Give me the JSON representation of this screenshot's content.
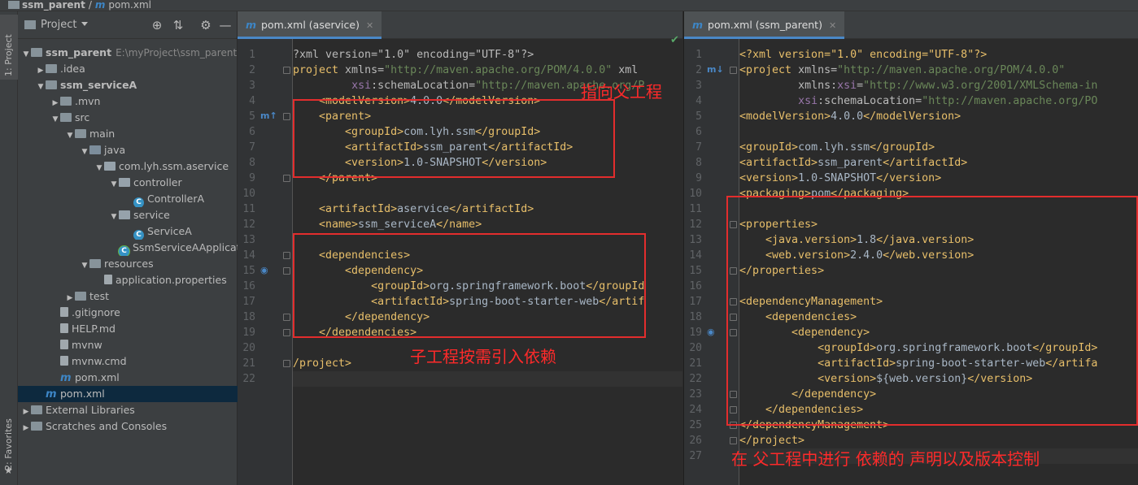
{
  "breadcrumb": {
    "project": "ssm_parent",
    "file": "pom.xml"
  },
  "toolstrip": {
    "project_tab": "1: Project",
    "favorites_tab": "2: Favorites"
  },
  "project_panel": {
    "title": "Project",
    "tree": [
      {
        "label": "ssm_parent",
        "extra": "E:\\myProject\\ssm_parent",
        "indent": 0,
        "arrow": "down",
        "icon": "module-folder-icon",
        "bold": true
      },
      {
        "label": ".idea",
        "indent": 1,
        "arrow": "right",
        "icon": "folder-icon"
      },
      {
        "label": "ssm_serviceA",
        "indent": 1,
        "arrow": "down",
        "icon": "module-folder-icon",
        "bold": true
      },
      {
        "label": ".mvn",
        "indent": 2,
        "arrow": "right",
        "icon": "folder-icon"
      },
      {
        "label": "src",
        "indent": 2,
        "arrow": "down",
        "icon": "folder-icon"
      },
      {
        "label": "main",
        "indent": 3,
        "arrow": "down",
        "icon": "folder-icon"
      },
      {
        "label": "java",
        "indent": 4,
        "arrow": "down",
        "icon": "source-folder-icon"
      },
      {
        "label": "com.lyh.ssm.aservice",
        "indent": 5,
        "arrow": "down",
        "icon": "package-icon"
      },
      {
        "label": "controller",
        "indent": 6,
        "arrow": "down",
        "icon": "package-icon"
      },
      {
        "label": "ControllerA",
        "indent": 7,
        "arrow": "",
        "icon": "class-icon"
      },
      {
        "label": "service",
        "indent": 6,
        "arrow": "down",
        "icon": "package-icon"
      },
      {
        "label": "ServiceA",
        "indent": 7,
        "arrow": "",
        "icon": "class-icon"
      },
      {
        "label": "SsmServiceAApplication",
        "indent": 6,
        "arrow": "",
        "icon": "spring-class-icon"
      },
      {
        "label": "resources",
        "indent": 4,
        "arrow": "down",
        "icon": "resources-folder-icon"
      },
      {
        "label": "application.properties",
        "indent": 5,
        "arrow": "",
        "icon": "properties-icon"
      },
      {
        "label": "test",
        "indent": 3,
        "arrow": "right",
        "icon": "folder-icon"
      },
      {
        "label": ".gitignore",
        "indent": 2,
        "arrow": "",
        "icon": "file-icon"
      },
      {
        "label": "HELP.md",
        "indent": 2,
        "arrow": "",
        "icon": "markdown-icon"
      },
      {
        "label": "mvnw",
        "indent": 2,
        "arrow": "",
        "icon": "file-icon"
      },
      {
        "label": "mvnw.cmd",
        "indent": 2,
        "arrow": "",
        "icon": "file-icon"
      },
      {
        "label": "pom.xml",
        "indent": 2,
        "arrow": "",
        "icon": "maven-icon"
      },
      {
        "label": "pom.xml",
        "indent": 1,
        "arrow": "",
        "icon": "maven-icon",
        "selected": true
      },
      {
        "label": "External Libraries",
        "indent": 0,
        "arrow": "right",
        "icon": "library-icon"
      },
      {
        "label": "Scratches and Consoles",
        "indent": 0,
        "arrow": "right",
        "icon": "scratches-icon"
      }
    ]
  },
  "left_editor": {
    "tab": "pom.xml (aservice)",
    "lines": [
      [
        [
          "p",
          "?xml version=\"1.0\" encoding=\"UTF-8\"?>"
        ]
      ],
      [
        [
          "t",
          "project "
        ],
        [
          "a",
          "xmlns="
        ],
        [
          "v",
          "\"http://maven.apache.org/POM/4.0.0\" "
        ],
        [
          "a",
          "xml"
        ]
      ],
      [
        [
          "p",
          "         "
        ],
        [
          "ns",
          "xsi"
        ],
        [
          "a",
          ":schemaLocation="
        ],
        [
          "v",
          "\"http://maven.apache.org/P"
        ]
      ],
      [
        [
          "p",
          "    "
        ],
        [
          "t",
          "<modelVersion>"
        ],
        [
          "tx",
          "4.0.0"
        ],
        [
          "t",
          "</modelVersion>"
        ]
      ],
      [
        [
          "p",
          "    "
        ],
        [
          "t",
          "<parent>"
        ]
      ],
      [
        [
          "p",
          "        "
        ],
        [
          "t",
          "<groupId>"
        ],
        [
          "tx",
          "com.lyh.ssm"
        ],
        [
          "t",
          "</groupId>"
        ]
      ],
      [
        [
          "p",
          "        "
        ],
        [
          "t",
          "<artifactId>"
        ],
        [
          "tx",
          "ssm_parent"
        ],
        [
          "t",
          "</artifactId>"
        ]
      ],
      [
        [
          "p",
          "        "
        ],
        [
          "t",
          "<version>"
        ],
        [
          "tx",
          "1.0-SNAPSHOT"
        ],
        [
          "t",
          "</version>"
        ]
      ],
      [
        [
          "p",
          "    "
        ],
        [
          "t",
          "</parent>"
        ]
      ],
      [],
      [
        [
          "p",
          "    "
        ],
        [
          "t",
          "<artifactId>"
        ],
        [
          "tx",
          "aservice"
        ],
        [
          "t",
          "</artifactId>"
        ]
      ],
      [
        [
          "p",
          "    "
        ],
        [
          "t",
          "<name>"
        ],
        [
          "tx",
          "ssm_serviceA"
        ],
        [
          "t",
          "</name>"
        ]
      ],
      [],
      [
        [
          "p",
          "    "
        ],
        [
          "t",
          "<dependencies>"
        ]
      ],
      [
        [
          "p",
          "        "
        ],
        [
          "t",
          "<dependency>"
        ]
      ],
      [
        [
          "p",
          "            "
        ],
        [
          "t",
          "<groupId>"
        ],
        [
          "tx",
          "org.springframework.boot"
        ],
        [
          "t",
          "</groupId"
        ]
      ],
      [
        [
          "p",
          "            "
        ],
        [
          "t",
          "<artifactId>"
        ],
        [
          "tx",
          "spring-boot-starter-web"
        ],
        [
          "t",
          "</artif"
        ]
      ],
      [
        [
          "p",
          "        "
        ],
        [
          "t",
          "</dependency>"
        ]
      ],
      [
        [
          "p",
          "    "
        ],
        [
          "t",
          "</dependencies>"
        ]
      ],
      [],
      [
        [
          "t",
          "/project>"
        ]
      ],
      []
    ],
    "notes": [
      "指向父工程",
      "子工程按需引入依赖"
    ]
  },
  "right_editor": {
    "tab": "pom.xml (ssm_parent)",
    "lines": [
      [
        [
          "t",
          "<?xml version=\"1.0\" encoding=\"UTF-8\"?>"
        ]
      ],
      [
        [
          "t",
          "<project "
        ],
        [
          "a",
          "xmlns="
        ],
        [
          "v",
          "\"http://maven.apache.org/POM/4.0.0\""
        ]
      ],
      [
        [
          "p",
          "         "
        ],
        [
          "a",
          "xmlns:"
        ],
        [
          "ns",
          "xsi"
        ],
        [
          "a",
          "="
        ],
        [
          "v",
          "\"http://www.w3.org/2001/XMLSchema-in"
        ]
      ],
      [
        [
          "p",
          "         "
        ],
        [
          "ns",
          "xsi"
        ],
        [
          "a",
          ":schemaLocation="
        ],
        [
          "v",
          "\"http://maven.apache.org/PO"
        ]
      ],
      [
        [
          "t",
          "<modelVersion>"
        ],
        [
          "tx",
          "4.0.0"
        ],
        [
          "t",
          "</modelVersion>"
        ]
      ],
      [],
      [
        [
          "t",
          "<groupId>"
        ],
        [
          "tx",
          "com.lyh.ssm"
        ],
        [
          "t",
          "</groupId>"
        ]
      ],
      [
        [
          "t",
          "<artifactId>"
        ],
        [
          "tx",
          "ssm_parent"
        ],
        [
          "t",
          "</artifactId>"
        ]
      ],
      [
        [
          "t",
          "<version>"
        ],
        [
          "tx",
          "1.0-SNAPSHOT"
        ],
        [
          "t",
          "</version>"
        ]
      ],
      [
        [
          "t",
          "<packaging>"
        ],
        [
          "tx",
          "pom"
        ],
        [
          "t",
          "</packaging>"
        ]
      ],
      [],
      [
        [
          "t",
          "<properties>"
        ]
      ],
      [
        [
          "p",
          "    "
        ],
        [
          "t",
          "<java.version>"
        ],
        [
          "tx",
          "1.8"
        ],
        [
          "t",
          "</java.version>"
        ]
      ],
      [
        [
          "p",
          "    "
        ],
        [
          "t",
          "<web.version>"
        ],
        [
          "tx",
          "2.4.0"
        ],
        [
          "t",
          "</web.version>"
        ]
      ],
      [
        [
          "t",
          "</properties>"
        ]
      ],
      [],
      [
        [
          "t",
          "<dependencyManagement>"
        ]
      ],
      [
        [
          "p",
          "    "
        ],
        [
          "t",
          "<dependencies>"
        ]
      ],
      [
        [
          "p",
          "        "
        ],
        [
          "t",
          "<dependency>"
        ]
      ],
      [
        [
          "p",
          "            "
        ],
        [
          "t",
          "<groupId>"
        ],
        [
          "tx",
          "org.springframework.boot"
        ],
        [
          "t",
          "</groupId>"
        ]
      ],
      [
        [
          "p",
          "            "
        ],
        [
          "t",
          "<artifactId>"
        ],
        [
          "tx",
          "spring-boot-starter-web"
        ],
        [
          "t",
          "</artifa"
        ]
      ],
      [
        [
          "p",
          "            "
        ],
        [
          "t",
          "<version>"
        ],
        [
          "tx",
          "${web.version}"
        ],
        [
          "t",
          "</version>"
        ]
      ],
      [
        [
          "p",
          "        "
        ],
        [
          "t",
          "</dependency>"
        ]
      ],
      [
        [
          "p",
          "    "
        ],
        [
          "t",
          "</dependencies>"
        ]
      ],
      [
        [
          "t",
          "</dependencyManagement>"
        ]
      ],
      [
        [
          "t",
          "</project>"
        ]
      ],
      []
    ],
    "notes": [
      "在 父工程中进行 依赖的 声明以及版本控制"
    ]
  }
}
